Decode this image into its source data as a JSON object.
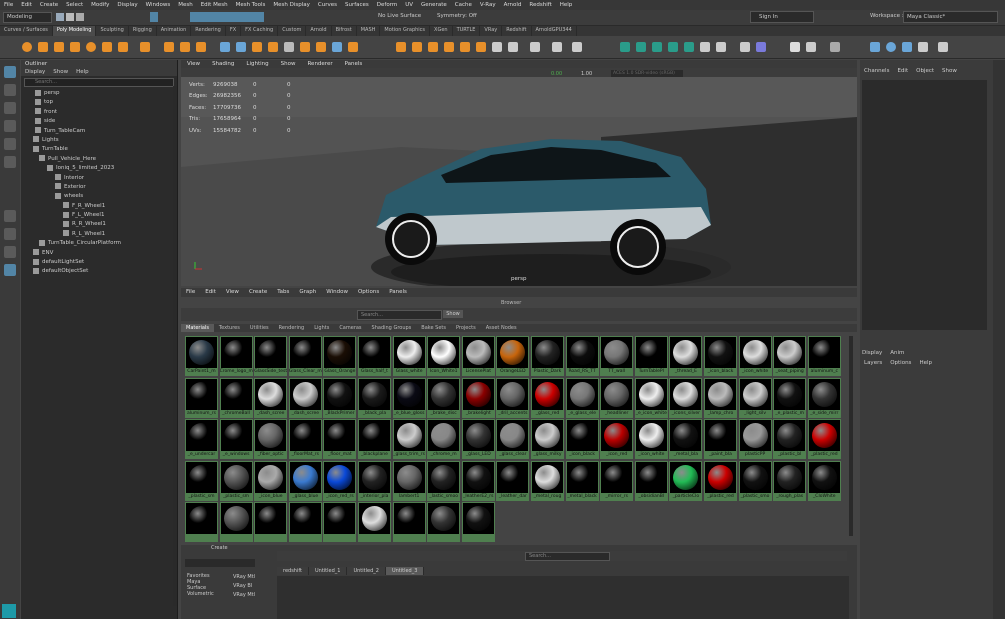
{
  "menu": [
    "File",
    "Edit",
    "Create",
    "Select",
    "Modify",
    "Display",
    "Windows",
    "Mesh",
    "Edit Mesh",
    "Mesh Tools",
    "Mesh Display",
    "Curves",
    "Surfaces",
    "Deform",
    "UV",
    "Generate",
    "Cache",
    "V-Ray",
    "Arnold",
    "Redshift",
    "Help"
  ],
  "workspace": {
    "label": "Workspace :",
    "value": "Maya Classic*"
  },
  "mode_select": "Modeling",
  "status": {
    "live_surface": "No Live Surface",
    "symmetry": "Symmetry: Off",
    "sign_in": "Sign In"
  },
  "shelf_tabs": [
    "Curves / Surfaces",
    "Poly Modeling",
    "Sculpting",
    "Rigging",
    "Animation",
    "Rendering",
    "FX",
    "FX Caching",
    "Custom",
    "Arnold",
    "Bifrost",
    "MASH",
    "Motion Graphics",
    "XGen",
    "TURTLE",
    "VRay",
    "Redshift",
    "ArnoldGPU344"
  ],
  "shelf_active": "Poly Modeling",
  "outliner": {
    "title": "Outliner",
    "menu": [
      "Display",
      "Show",
      "Help"
    ],
    "search": "Search...",
    "rows": [
      {
        "label": "persp"
      },
      {
        "label": "top"
      },
      {
        "label": "front"
      },
      {
        "label": "side"
      },
      {
        "label": "Turn_TableCam"
      },
      {
        "label": "Lights"
      },
      {
        "label": "TurnTable"
      },
      {
        "label": "Pull_Vehicle_Here"
      },
      {
        "label": "Ioniq_5_limited_2023"
      },
      {
        "label": "Interior"
      },
      {
        "label": "Exterior"
      },
      {
        "label": "wheels"
      },
      {
        "label": "F_R_Wheel1"
      },
      {
        "label": "F_L_Wheel1"
      },
      {
        "label": "R_R_Wheel1"
      },
      {
        "label": "R_L_Wheel1"
      },
      {
        "label": "TurnTable_CircularPlatform"
      },
      {
        "label": "ENV"
      },
      {
        "label": "defaultLightSet"
      },
      {
        "label": "defaultObjectSet"
      }
    ]
  },
  "viewport": {
    "menu": [
      "View",
      "Shading",
      "Lighting",
      "Show",
      "Renderer",
      "Panels"
    ],
    "camera": "persp",
    "exposure": "0.00",
    "gamma": "1.00",
    "color_space": "ACES 1.0 SDR-video (sRGB)",
    "hud": [
      {
        "label": "Verts:",
        "v1": "9269038",
        "v2": "0",
        "v3": "0"
      },
      {
        "label": "Edges:",
        "v1": "26982356",
        "v2": "0",
        "v3": "0"
      },
      {
        "label": "Faces:",
        "v1": "17709736",
        "v2": "0",
        "v3": "0"
      },
      {
        "label": "Tris:",
        "v1": "17658964",
        "v2": "0",
        "v3": "0"
      },
      {
        "label": "UVs:",
        "v1": "15584782",
        "v2": "0",
        "v3": "0"
      }
    ]
  },
  "browser": {
    "menu": [
      "File",
      "Edit",
      "View",
      "Create",
      "Tabs",
      "Graph",
      "Window",
      "Options",
      "Panels"
    ],
    "title": "Browser",
    "search": "Search...",
    "show": "Show",
    "tabs": [
      "Materials",
      "Textures",
      "Utilities",
      "Rendering",
      "Lights",
      "Cameras",
      "Shading Groups",
      "Bake Sets",
      "Projects",
      "Asset Nodes"
    ],
    "active_tab": "Materials",
    "swatches": [
      {
        "label": "CarPaint1_m",
        "color": "#2a3a48"
      },
      {
        "label": "Crome_logo_m",
        "color": "#000"
      },
      {
        "label": "GlassSide_test",
        "color": "#000"
      },
      {
        "label": "Glass_Clear_m",
        "color": "#000"
      },
      {
        "label": "Glass_Orange",
        "color": "#1a0e05"
      },
      {
        "label": "Glass_half_t",
        "color": "#000"
      },
      {
        "label": "Glass_white",
        "color": "#eee"
      },
      {
        "label": "Icon_White1",
        "color": "#fff"
      },
      {
        "label": "LicensePlat",
        "color": "#bbb"
      },
      {
        "label": "OrangeLED",
        "color": "#c8650c"
      },
      {
        "label": "Plastic_Dark",
        "color": "#222"
      },
      {
        "label": "Road_RS_TT",
        "color": "#0c0c0c"
      },
      {
        "label": "TT_wall",
        "color": "#777"
      },
      {
        "label": "TurnTablePl",
        "color": "#000"
      },
      {
        "label": "_thread_E",
        "color": "#ddd"
      },
      {
        "label": "_icon_black",
        "color": "#111"
      },
      {
        "label": "_icon_white",
        "color": "#ddd"
      },
      {
        "label": "_seat_piping",
        "color": "#ccc"
      },
      {
        "label": "aluminum_c",
        "color": "#000"
      },
      {
        "label": "aluminum_rs",
        "color": "#000"
      },
      {
        "label": "_chromeBall",
        "color": "#000"
      },
      {
        "label": "_dash_scree",
        "color": "#ddd"
      },
      {
        "label": "_dash_scree",
        "color": "#ccc"
      },
      {
        "label": "_BlackPrimer",
        "color": "#111"
      },
      {
        "label": "_black_pla",
        "color": "#1a1a1a"
      },
      {
        "label": "_e_blue_gloss",
        "color": "#0a0a14"
      },
      {
        "label": "_brake_disc",
        "color": "#333"
      },
      {
        "label": "_brakelight",
        "color": "#8b0000"
      },
      {
        "label": "_dril_accents",
        "color": "#666"
      },
      {
        "label": "_glass_red",
        "color": "#c00"
      },
      {
        "label": "_e_glass_ele",
        "color": "#777"
      },
      {
        "label": "_headliner",
        "color": "#666"
      },
      {
        "label": "_e_icon_white",
        "color": "#eee"
      },
      {
        "label": "_icons_silver",
        "color": "#ddd"
      },
      {
        "label": "_lamp_chro",
        "color": "#bbb"
      },
      {
        "label": "_light_silv",
        "color": "#ccc"
      },
      {
        "label": "_e_plastic_m",
        "color": "#111"
      },
      {
        "label": "_e_side_mirr",
        "color": "#333"
      },
      {
        "label": "_e_undercar",
        "color": "#000"
      },
      {
        "label": "_e_windows",
        "color": "#000"
      },
      {
        "label": "_fiber_optic",
        "color": "#666"
      },
      {
        "label": "_floorMat_rs",
        "color": "#000"
      },
      {
        "label": "_floor_mat",
        "color": "#000"
      },
      {
        "label": "_blackplane",
        "color": "#000"
      },
      {
        "label": "_glass_trim_rs",
        "color": "#ccc"
      },
      {
        "label": "_chrome_m",
        "color": "#888"
      },
      {
        "label": "_glass_LED",
        "color": "#333"
      },
      {
        "label": "_glass_clear",
        "color": "#888"
      },
      {
        "label": "_glass_milky",
        "color": "#ccc"
      },
      {
        "label": "_icon_black",
        "color": "#000"
      },
      {
        "label": "_icon_red",
        "color": "#b00"
      },
      {
        "label": "_icon_white",
        "color": "#eee"
      },
      {
        "label": "_metal_bla",
        "color": "#111"
      },
      {
        "label": "_paint_bla",
        "color": "#000"
      },
      {
        "label": "plasticPP",
        "color": "#999"
      },
      {
        "label": "_plastic_bl",
        "color": "#222"
      },
      {
        "label": "_plastic_red",
        "color": "#c00"
      },
      {
        "label": "_plastic_sm",
        "color": "#000"
      },
      {
        "label": "_plastic_sm",
        "color": "#555"
      },
      {
        "label": "_icon_blue",
        "color": "#aaa"
      },
      {
        "label": "_glass_blue",
        "color": "#3a7ad0"
      },
      {
        "label": "_icon_red_rs",
        "color": "#0a49d8"
      },
      {
        "label": "_interior_pla",
        "color": "#222"
      },
      {
        "label": "lambert1",
        "color": "#666"
      },
      {
        "label": "_lastic_smoo",
        "color": "#222"
      },
      {
        "label": "_leatherE2_rs",
        "color": "#111"
      },
      {
        "label": "_leather_dar",
        "color": "#000"
      },
      {
        "label": "_metal_roug",
        "color": "#ddd"
      },
      {
        "label": "_metal_black",
        "color": "#000"
      },
      {
        "label": "_mirror_rs",
        "color": "#000"
      },
      {
        "label": "_obsidianBl",
        "color": "#000"
      },
      {
        "label": "_particleClo",
        "color": "#2b5"
      },
      {
        "label": "_plastic_red",
        "color": "#c00"
      },
      {
        "label": "_plastic_smo",
        "color": "#111"
      },
      {
        "label": "_rough_plas",
        "color": "#222"
      },
      {
        "label": "_CloWhite",
        "color": "#111"
      },
      {
        "label": "",
        "color": "#000"
      },
      {
        "label": "",
        "color": "#555"
      },
      {
        "label": "",
        "color": "#000"
      },
      {
        "label": "",
        "color": "#000"
      },
      {
        "label": "",
        "color": "#000"
      },
      {
        "label": "",
        "color": "#ddd"
      },
      {
        "label": "",
        "color": "#000"
      },
      {
        "label": "",
        "color": "#333"
      },
      {
        "label": "",
        "color": "#111"
      }
    ]
  },
  "bottom": {
    "create_label": "Create",
    "tabs": [
      "redshift",
      "Untitled_1",
      "Untitled_2",
      "Untitled_3"
    ],
    "active_tab": "Untitled_3",
    "search": "Search...",
    "favorites": [
      "Favorites",
      "Maya",
      "Surface",
      "Volumetric"
    ],
    "vray": [
      "VRay Mtl",
      "VRay Bl",
      "VRay Mtl"
    ]
  },
  "right": {
    "menu": [
      "Channels",
      "Edit",
      "Object",
      "Show"
    ],
    "display_tabs": [
      "Display",
      "Anim"
    ],
    "display_menu": [
      "Layers",
      "Options",
      "Help"
    ]
  },
  "colors": {
    "accent": "#5285a6",
    "selected_swatch": "#4f7f4f",
    "car": "#2b5a6a"
  }
}
